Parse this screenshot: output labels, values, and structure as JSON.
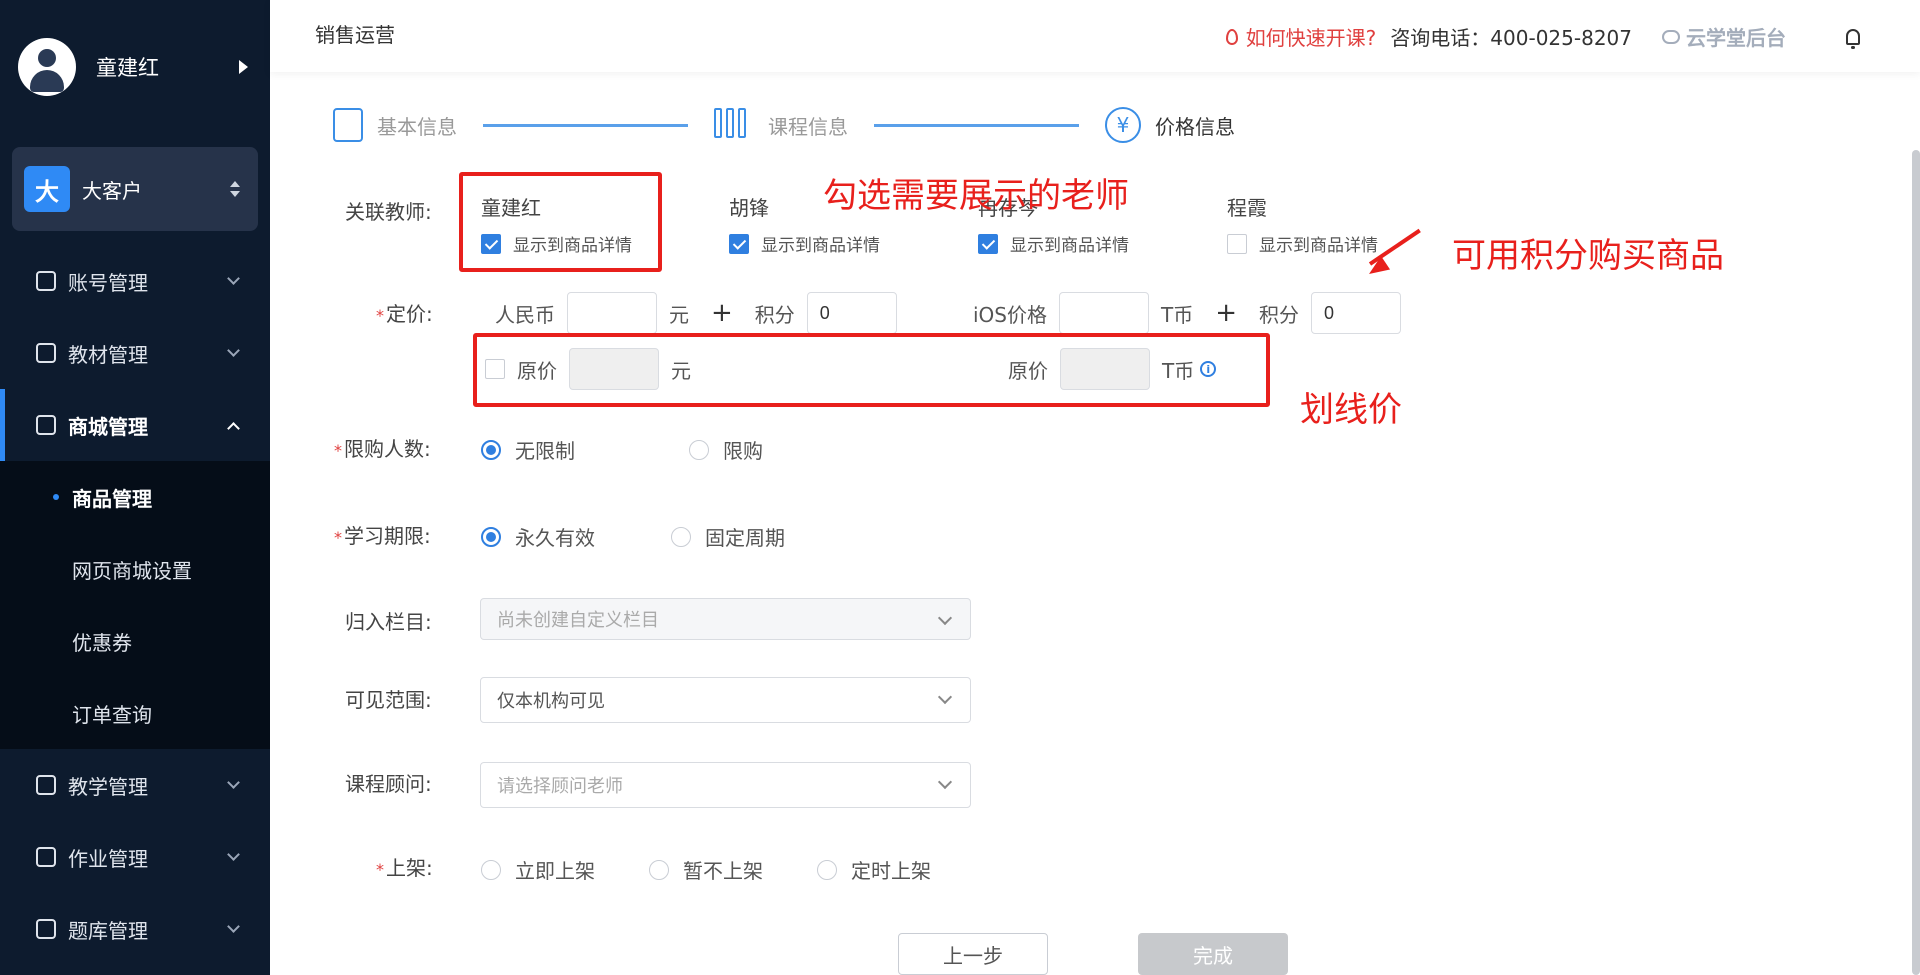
{
  "sidebar": {
    "user_name": "童建红",
    "org_logo_text": "大",
    "org_name": "大客户",
    "menu": [
      {
        "label": "账号管理",
        "icon": "user-icon"
      },
      {
        "label": "教材管理",
        "icon": "book-icon"
      },
      {
        "label": "商城管理",
        "icon": "store-icon",
        "expanded": true
      },
      {
        "label": "教学管理",
        "icon": "teaching-icon"
      },
      {
        "label": "作业管理",
        "icon": "homework-icon"
      },
      {
        "label": "题库管理",
        "icon": "question-bank-icon"
      }
    ],
    "submenu": [
      {
        "label": "商品管理",
        "active": true
      },
      {
        "label": "网页商城设置"
      },
      {
        "label": "优惠券"
      },
      {
        "label": "订单查询"
      }
    ]
  },
  "header": {
    "breadcrumb": "销售运营",
    "help_link": "如何快速开课?",
    "phone": "咨询电话：400-025-8207",
    "brand": "云学堂后台"
  },
  "steps": [
    {
      "label": "基本信息",
      "icon": "document-icon"
    },
    {
      "label": "课程信息",
      "icon": "books-icon"
    },
    {
      "label": "价格信息",
      "icon": "yen-icon",
      "current": true
    }
  ],
  "form": {
    "teachers_label": "关联教师:",
    "teachers": [
      {
        "name": "童建红",
        "checked": true
      },
      {
        "name": "胡锋",
        "checked": true
      },
      {
        "name": "冉存芩",
        "checked": true
      },
      {
        "name": "程霞",
        "checked": false
      }
    ],
    "show_detail_label": "显示到商品详情",
    "price_label": "定价:",
    "rmb_label": "人民币",
    "yuan": "元",
    "points_label": "积分",
    "points_value": "0",
    "ios_label": "iOS价格",
    "tcoin": "T币",
    "ios_points_value": "0",
    "orig_price_label": "原价",
    "limit_label": "限购人数:",
    "limit_options": [
      "无限制",
      "限购"
    ],
    "period_label": "学习期限:",
    "period_options": [
      "永久有效",
      "固定周期"
    ],
    "category_label": "归入栏目:",
    "category_placeholder": "尚未创建自定义栏目",
    "visibility_label": "可见范围:",
    "visibility_value": "仅本机构可见",
    "advisor_label": "课程顾问:",
    "advisor_placeholder": "请选择顾问老师",
    "shelf_label": "上架:",
    "shelf_options": [
      "立即上架",
      "暂不上架",
      "定时上架"
    ],
    "prev_button": "上一步",
    "done_button": "完成"
  },
  "annotations": {
    "teachers_note": "勾选需要展示的老师",
    "points_note": "可用积分购买商品",
    "strike_note": "划线价",
    "color": "#e8201c"
  },
  "colors": {
    "sidebar_bg": "#0d1b2e",
    "accent": "#2f7fe0",
    "help_red": "#e0403f"
  }
}
